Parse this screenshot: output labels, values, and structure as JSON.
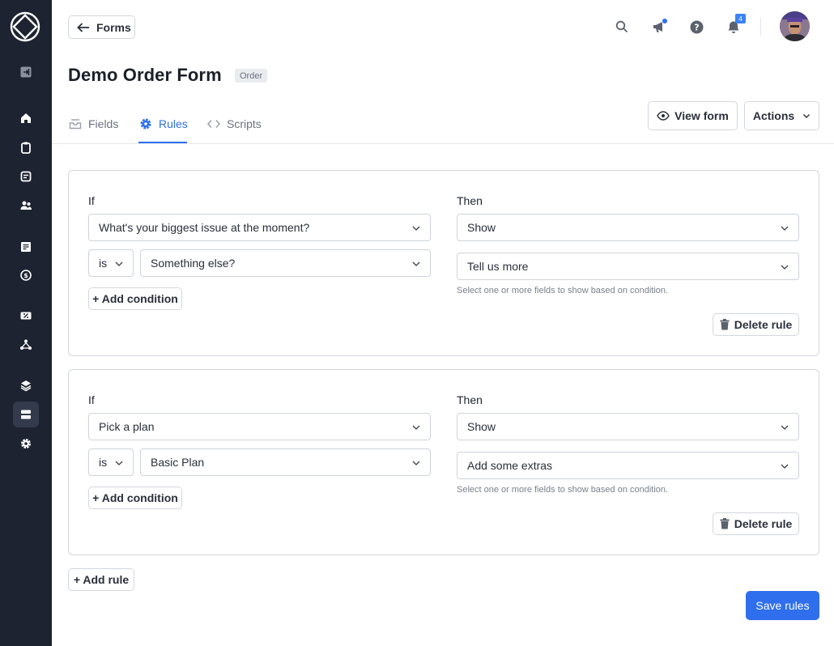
{
  "header": {
    "back_label": "Forms",
    "notification_count": "4"
  },
  "page": {
    "title": "Demo Order Form",
    "type_badge": "Order"
  },
  "tabs": [
    {
      "label": "Fields",
      "icon": "inbox-icon"
    },
    {
      "label": "Rules",
      "icon": "gear-icon",
      "active": true
    },
    {
      "label": "Scripts",
      "icon": "code-icon"
    }
  ],
  "actions": {
    "view_form": "View form",
    "actions": "Actions"
  },
  "rules": [
    {
      "if_label": "If",
      "then_label": "Then",
      "field": "What's your biggest issue at the moment?",
      "operator": "is",
      "value": "Something else?",
      "add_condition": "+ Add condition",
      "action": "Show",
      "target": "Tell us more",
      "help": "Select one or more fields to show based on condition.",
      "delete": "Delete rule"
    },
    {
      "if_label": "If",
      "then_label": "Then",
      "field": "Pick a plan",
      "operator": "is",
      "value": "Basic Plan",
      "add_condition": "+ Add condition",
      "action": "Show",
      "target": "Add some extras",
      "help": "Select one or more fields to show based on condition.",
      "delete": "Delete rule"
    }
  ],
  "footer": {
    "add_rule": "+ Add rule",
    "save_rules": "Save rules"
  },
  "colors": {
    "sidebar": "#1d2331",
    "accent": "#2f6fed"
  }
}
